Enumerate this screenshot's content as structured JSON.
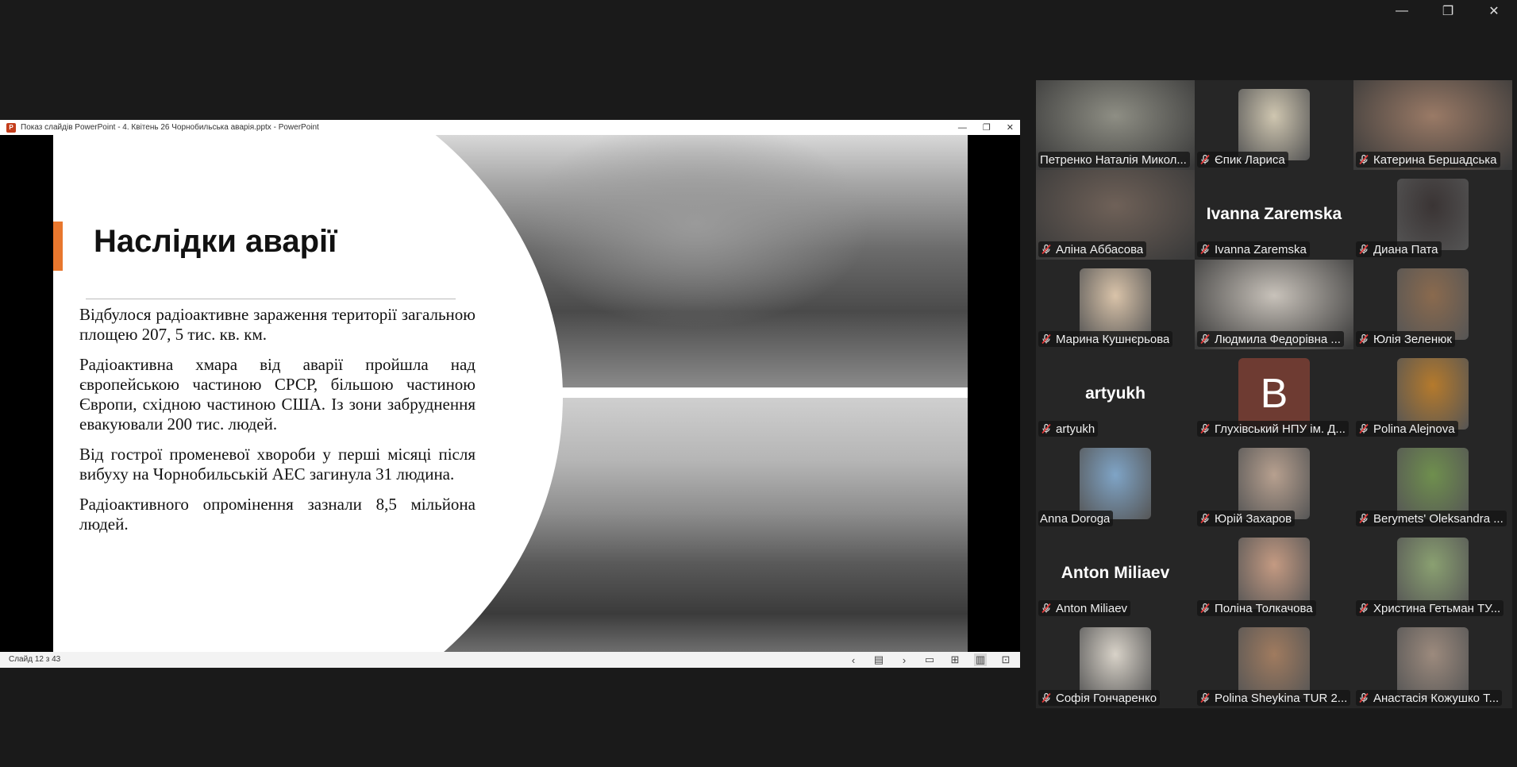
{
  "window_controls": [
    "—",
    "❐",
    "✕"
  ],
  "ppt": {
    "title": "Показ слайдів PowerPoint  -  4. Квітень 26 Чорнобильська аварія.pptx - PowerPoint",
    "title_controls": [
      "—",
      "❐",
      "✕"
    ],
    "slide": {
      "title": "Наслідки аварії",
      "paragraphs": [
        "Відбулося радіоактивне зараження території загальною площею 207, 5 тис. кв. км.",
        "Радіоактивна хмара від аварії пройшла над європейською частиною СРСР, більшою частиною Європи, східною частиною США. Із зони забруднення евакуювали 200 тис. людей.",
        "Від гострої променевої хвороби у перші місяці після вибуху на Чорнобильській АЕС загинула 31 людина.",
        "Радіоактивного опромінення зазнали 8,5 мільйона людей."
      ]
    },
    "status_text": "Слайд 12 з 43",
    "status_controls": [
      "‹",
      "▤",
      "›",
      "▭",
      "⊞",
      "▥",
      "⊡"
    ]
  },
  "participants": [
    {
      "name": "Петренко Наталія Микол...",
      "kind": "video",
      "color": "#8e8e84",
      "speaking": true,
      "muted": false
    },
    {
      "name": "Єпик Лариса",
      "kind": "thumb",
      "color": "#cfc6b0",
      "muted": true
    },
    {
      "name": "Катерина Бершадська",
      "kind": "video",
      "color": "#9a7a66",
      "muted": true
    },
    {
      "name": "Аліна Аббасова",
      "kind": "video",
      "color": "#6f6158",
      "muted": true
    },
    {
      "name": "Ivanna Zaremska",
      "kind": "text",
      "display": "Ivanna Zaremska",
      "muted": true
    },
    {
      "name": "Диана Пата",
      "kind": "thumb",
      "color": "#3a3434",
      "muted": true
    },
    {
      "name": "Марина Кушнєрьова",
      "kind": "thumb",
      "color": "#d9c3a9",
      "muted": true
    },
    {
      "name": "Людмила Федорівна ...",
      "kind": "video",
      "color": "#c8c2ba",
      "muted": true
    },
    {
      "name": "Юлія Зеленюк",
      "kind": "thumb",
      "color": "#8a6a4e",
      "muted": true
    },
    {
      "name": "artyukh",
      "kind": "text",
      "display": "artyukh",
      "muted": true
    },
    {
      "name": "Глухівський НПУ ім. Д...",
      "kind": "letter",
      "display": "B",
      "muted": true
    },
    {
      "name": "Polina Alejnova",
      "kind": "thumb",
      "color": "#b57a2c",
      "muted": true
    },
    {
      "name": "Anna Doroga",
      "kind": "thumb",
      "color": "#7fa4c6",
      "muted": false
    },
    {
      "name": "Юрій Захаров",
      "kind": "thumb",
      "color": "#b7a08f",
      "muted": true
    },
    {
      "name": "Berymets' Oleksandra ...",
      "kind": "thumb",
      "color": "#6f8f4e",
      "muted": true
    },
    {
      "name": "Anton Miliaev",
      "kind": "text",
      "display": "Anton Miliaev",
      "muted": true
    },
    {
      "name": "Поліна Толкачова",
      "kind": "thumb",
      "color": "#c49a82",
      "muted": true
    },
    {
      "name": "Христина Гетьман ТУ...",
      "kind": "thumb",
      "color": "#8aa071",
      "muted": true
    },
    {
      "name": "Софія Гончаренко",
      "kind": "thumb",
      "color": "#d8d2c8",
      "muted": true
    },
    {
      "name": "Polina Sheykina TUR 2...",
      "kind": "thumb",
      "color": "#a07b5f",
      "muted": true
    },
    {
      "name": "Анастасія Кожушко Т...",
      "kind": "thumb",
      "color": "#9c8a7d",
      "muted": true
    }
  ]
}
